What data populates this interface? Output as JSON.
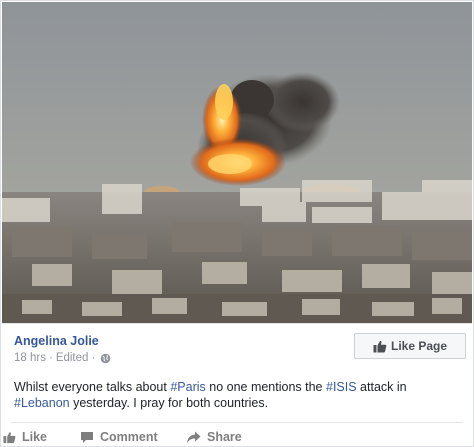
{
  "post": {
    "author": "Angelina Jolie",
    "meta_time": "18 hrs",
    "meta_sep": "·",
    "meta_edited": "Edited ·",
    "like_page_label": "Like Page",
    "text_segments": [
      {
        "text": "Whilst everyone talks about ",
        "hashtag": false
      },
      {
        "text": "#Paris",
        "hashtag": true
      },
      {
        "text": " no one mentions the ",
        "hashtag": false
      },
      {
        "text": "#ISIS",
        "hashtag": true
      },
      {
        "text": " attack in ",
        "hashtag": false
      },
      {
        "text": "#Lebanon",
        "hashtag": true
      },
      {
        "text": " yesterday. I pray for both countries.",
        "hashtag": false
      }
    ]
  },
  "actions": {
    "like": "Like",
    "comment": "Comment",
    "share": "Share"
  },
  "icons": {
    "like_page": "thumbs-up-icon",
    "privacy": "globe-icon",
    "like": "thumbs-up-icon",
    "comment": "comment-bubble-icon",
    "share": "share-arrow-icon"
  },
  "colors": {
    "link": "#365899",
    "meta": "#90949c",
    "action": "#7f7f7f"
  }
}
